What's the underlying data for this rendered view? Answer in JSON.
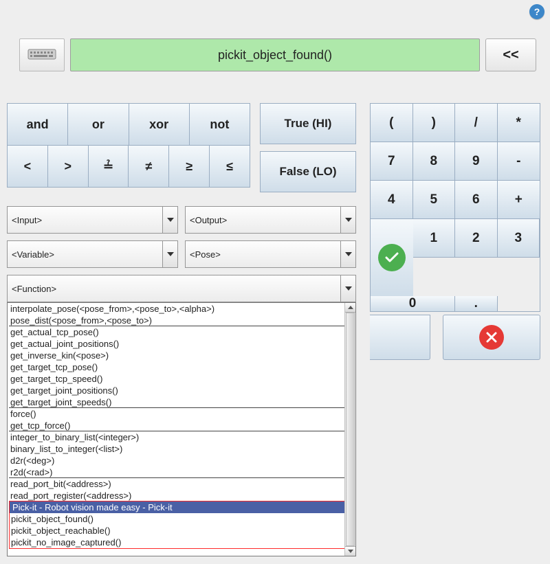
{
  "help": "?",
  "expression": "pickit_object_found()",
  "back_label": "<<",
  "logic": {
    "and": "and",
    "or": "or",
    "xor": "xor",
    "not": "not",
    "lt": "<",
    "gt": ">",
    "qeq": "≟",
    "ne": "≠",
    "ge": "≥",
    "le": "≤"
  },
  "tf": {
    "true_label": "True (HI)",
    "false_label": "False (LO)"
  },
  "numpad": {
    "lpar": "(",
    "rpar": ")",
    "div": "/",
    "mul": "*",
    "k7": "7",
    "k8": "8",
    "k9": "9",
    "minus": "-",
    "k4": "4",
    "k5": "5",
    "k6": "6",
    "plus": "+",
    "k1": "1",
    "k2": "2",
    "k3": "3",
    "k0": "0",
    "dot": "."
  },
  "dropdowns": {
    "input": "<Input>",
    "output": "<Output>",
    "variable": "<Variable>",
    "pose": "<Pose>",
    "function": "<Function>"
  },
  "functions": {
    "groups": [
      {
        "items": [
          "interpolate_pose(<pose_from>,<pose_to>,<alpha>)",
          "pose_dist(<pose_from>,<pose_to>)"
        ]
      },
      {
        "items": [
          "get_actual_tcp_pose()",
          "get_actual_joint_positions()",
          "get_inverse_kin(<pose>)",
          "get_target_tcp_pose()",
          "get_target_tcp_speed()",
          "get_target_joint_positions()",
          "get_target_joint_speeds()"
        ]
      },
      {
        "items": [
          "force()",
          "get_tcp_force()"
        ]
      },
      {
        "items": [
          "integer_to_binary_list(<integer>)",
          "binary_list_to_integer(<list>)",
          "d2r(<deg>)",
          "r2d(<rad>)"
        ]
      },
      {
        "items": [
          "read_port_bit(<address>)",
          "read_port_register(<address>)"
        ]
      }
    ],
    "pickit": {
      "header": "Pick-it - Robot vision made easy - Pick-it",
      "items": [
        "pickit_object_found()",
        "pickit_object_reachable()",
        "pickit_no_image_captured()"
      ]
    }
  }
}
